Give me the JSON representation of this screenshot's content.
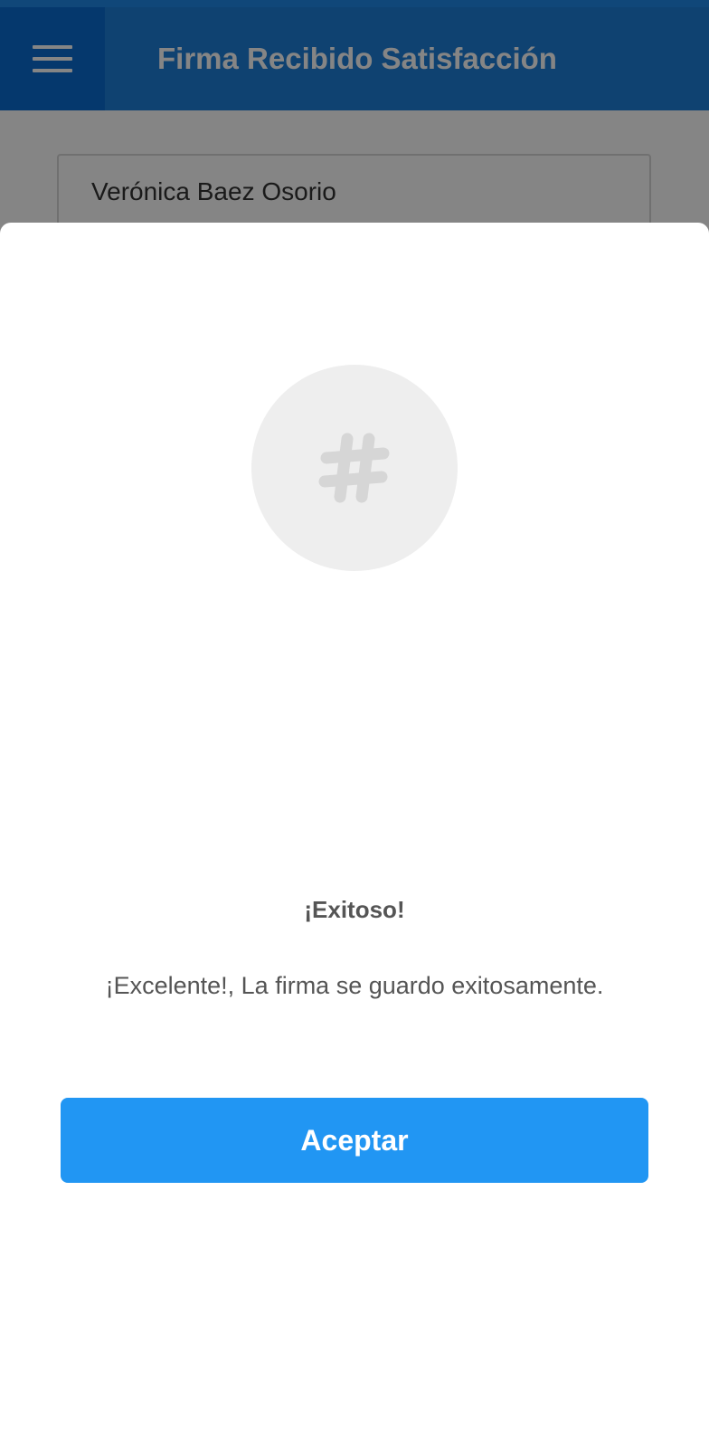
{
  "app_bar": {
    "title": "Firma Recibido Satisfacción",
    "menu_icon": "hamburger-menu-icon",
    "color": "#1e7fd8"
  },
  "form": {
    "name_value": "Verónica Baez Osorio"
  },
  "modal": {
    "icon": "hashtag-icon",
    "title": "¡Exitoso!",
    "message": "¡Excelente!, La firma se guardo exitosamente.",
    "accept_label": "Aceptar",
    "accent_color": "#2196f3"
  }
}
